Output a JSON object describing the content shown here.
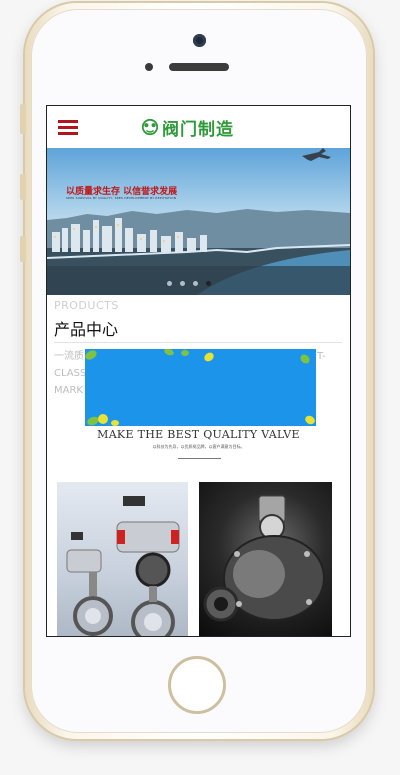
{
  "site": {
    "logo_text": "阀门制造",
    "menu_icon": "hamburger-menu-icon",
    "brand_color": "#b0161b",
    "logo_color": "#2f9a3a"
  },
  "banner": {
    "slogan": "以质量求生存  以信誉求发展",
    "slogan_en": "SEEK SURVIVAL BY QUALITY, SEEK DEVELOPMENT BY REPUTATION",
    "slide_count": 4,
    "active_slide": 4
  },
  "products": {
    "heading_en": "PRODUCTS",
    "heading_cn": "产品中心",
    "desc_line1": "一流质",
    "desc_line1_tail": "T-",
    "desc_line2": "CLASS",
    "desc_line3": "MARK",
    "valve_title": "MAKE THE BEST QUALITY VALVE",
    "valve_subtitle": "以科技为先导，以优质树品牌，以客户满意为目标。"
  },
  "ad": {
    "background_color": "#1c94ea"
  }
}
